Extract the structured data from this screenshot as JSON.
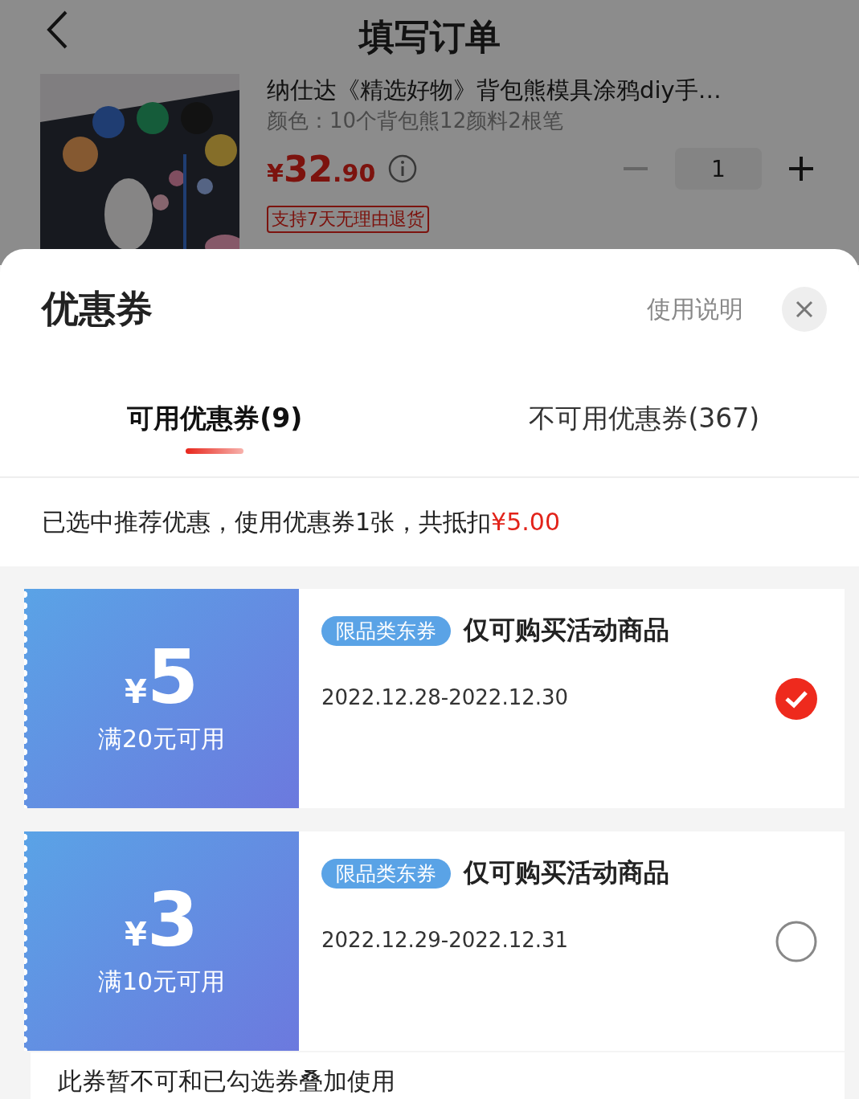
{
  "header": {
    "title": "填写订单"
  },
  "product": {
    "title": "纳仕达《精选好物》背包熊模具涂鸦diy手…",
    "spec": "颜色：10个背包熊12颜料2根笔",
    "price": {
      "currency": "¥",
      "integer": "32",
      "decimal": ".90"
    },
    "quantity": {
      "value": "1",
      "decrease_disabled": true
    },
    "badge": "支持7天无理由退货"
  },
  "sheet": {
    "title": "优惠券",
    "help_link": "使用说明",
    "tabs": [
      {
        "label": "可用优惠券(9)",
        "selected": true
      },
      {
        "label": "不可用优惠券(367)",
        "selected": false
      }
    ],
    "summary": {
      "text": "已选中推荐优惠，使用优惠券1张，共抵扣",
      "amount": "¥5.00"
    },
    "coupons": [
      {
        "currency": "¥",
        "amount": "5",
        "condition": "满20元可用",
        "tag": "限品类东券",
        "description": "仅可购买活动商品",
        "dates": "2022.12.28-2022.12.30",
        "selected": true
      },
      {
        "currency": "¥",
        "amount": "3",
        "condition": "满10元可用",
        "tag": "限品类东券",
        "description": "仅可购买活动商品",
        "dates": "2022.12.29-2022.12.31",
        "selected": false
      }
    ],
    "note": "此券暂不可和已勾选券叠加使用"
  }
}
